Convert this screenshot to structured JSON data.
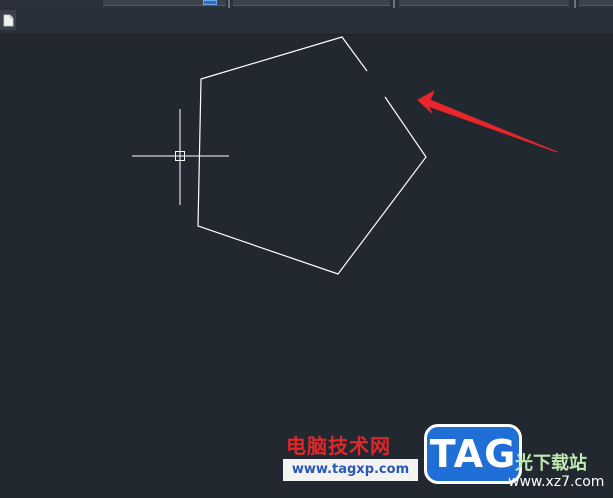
{
  "colors": {
    "canvas_background": "#212830",
    "geometry_stroke": "#ffffff",
    "annotation_arrow": "#e8262b",
    "watermark_red": "#e0272a",
    "watermark_blue": "#1f6fd6"
  },
  "icons": {
    "document_button": "document-icon",
    "crosshair": "crosshair-cursor-icon",
    "arrow": "red-arrow-annotation-icon"
  },
  "watermark": {
    "site_title": "电脑技术网",
    "site_url": "www.tagxp.com",
    "badge_text": "TAG",
    "partner_name": "光下载站",
    "partner_url": "www.xz7.com"
  }
}
